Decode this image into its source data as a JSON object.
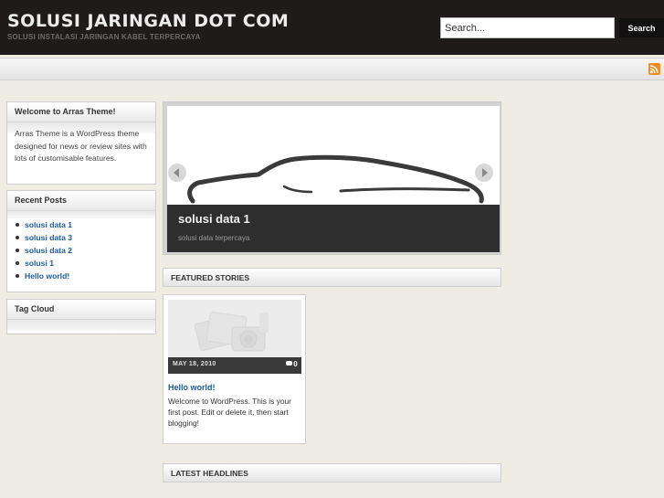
{
  "header": {
    "title": "SOLUSI JARINGAN DOT COM",
    "tagline": "SOLUSI INSTALASI JARINGAN KABEL TERPERCAYA",
    "search_value": "Search...",
    "search_button": "Search"
  },
  "navbar": {
    "rss_icon": "rss-icon"
  },
  "sidebar": {
    "welcome": {
      "title": "Welcome to Arras Theme!",
      "body": "Arras Theme is a WordPress theme designed for news or review sites with lots of customisable features."
    },
    "recent_posts": {
      "title": "Recent Posts",
      "items": [
        "solusi data 1",
        "solusi data 3",
        "solusi data 2",
        "solusi 1",
        "Hello world!"
      ]
    },
    "tag_cloud": {
      "title": "Tag Cloud"
    }
  },
  "slideshow": {
    "title": "solusi data 1",
    "subtitle": "solusi data terpercaya",
    "prev_icon": "arrow-left-icon",
    "next_icon": "arrow-right-icon"
  },
  "featured": {
    "heading": "FEATURED STORIES",
    "post": {
      "date": "MAY 18, 2010",
      "comments": "0",
      "title": "Hello world!",
      "excerpt": "Welcome to WordPress. This is your first post. Edit or delete it, then start blogging!"
    }
  },
  "latest": {
    "heading": "LATEST HEADLINES"
  },
  "colors": {
    "header_bg": "#1f1b1b",
    "link": "#1c5ba0",
    "page_bg": "#efece4",
    "caption_bg": "#2e2e2e",
    "rss": "#f28a1c"
  }
}
